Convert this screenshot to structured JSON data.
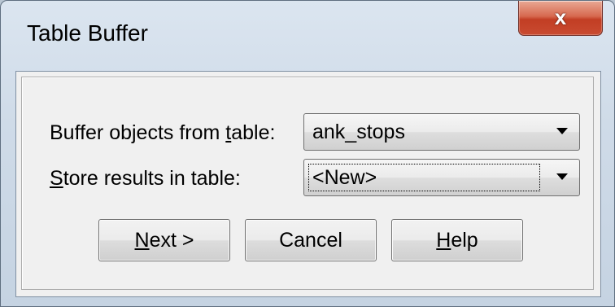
{
  "window": {
    "title": "Table Buffer",
    "close_glyph": "x"
  },
  "form": {
    "buffer_label_prefix": "Buffer objects from ",
    "buffer_label_mnemonic": "t",
    "buffer_label_suffix": "able:",
    "buffer_value": "ank_stops",
    "store_label_mnemonic": "S",
    "store_label_suffix": "tore results in table:",
    "store_value": "<New>"
  },
  "buttons": {
    "next_mnemonic": "N",
    "next_suffix": "ext >",
    "cancel_label": "Cancel",
    "help_mnemonic": "H",
    "help_suffix": "elp"
  },
  "icons": {
    "close": "close-icon",
    "dropdown": "chevron-down-icon"
  },
  "colors": {
    "close_button": "#c94b31",
    "dialog_face": "#f0f0f0",
    "frame": "#cfdbe8"
  }
}
